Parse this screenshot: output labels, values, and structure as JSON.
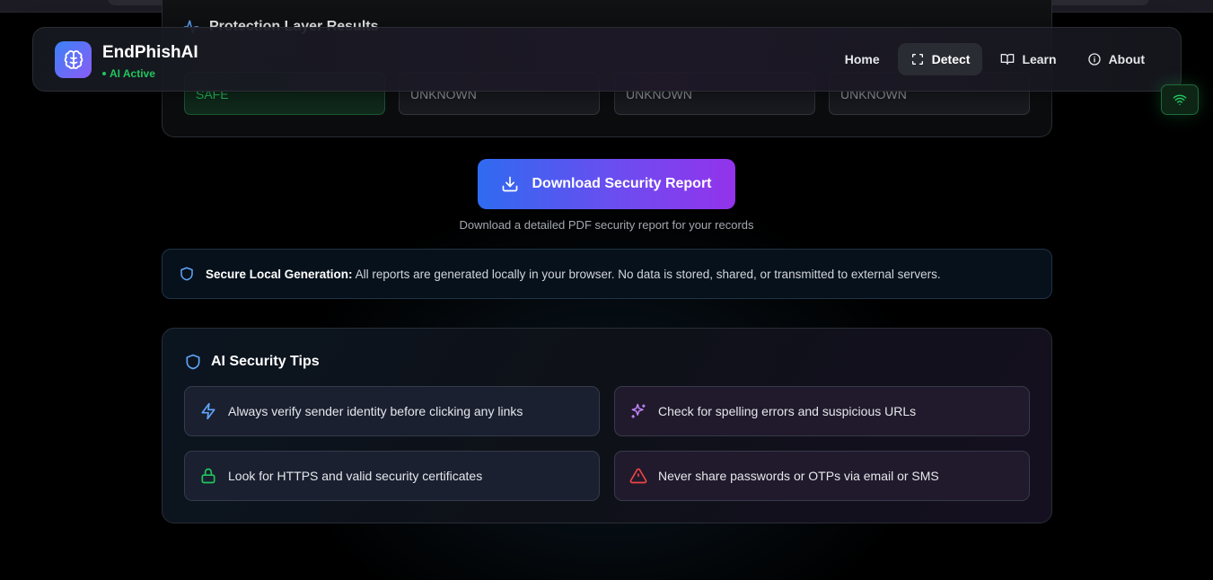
{
  "results": {
    "title": "Protection Layer Results",
    "layers": [
      "SAFE",
      "UNKNOWN",
      "UNKNOWN",
      "UNKNOWN"
    ]
  },
  "nav": {
    "brand": "EndPhishAI",
    "status": "AI Active",
    "links": [
      {
        "label": "Home",
        "icon": "home"
      },
      {
        "label": "Detect",
        "icon": "scan-icon",
        "active": true
      },
      {
        "label": "Learn",
        "icon": "book-icon"
      },
      {
        "label": "About",
        "icon": "info-icon"
      }
    ]
  },
  "download": {
    "label": "Download Security Report",
    "hint": "Download a detailed PDF security report for your records"
  },
  "secure_note": {
    "title": "Secure Local Generation:",
    "text": "All reports are generated locally in your browser. No data is stored, shared, or transmitted to external servers."
  },
  "tips": {
    "title": "AI Security Tips",
    "items": [
      {
        "text": "Always verify sender identity before clicking any links",
        "icon": "lightning-icon"
      },
      {
        "text": "Check for spelling errors and suspicious URLs",
        "icon": "sparkles-icon"
      },
      {
        "text": "Look for HTTPS and valid security certificates",
        "icon": "lock-icon"
      },
      {
        "text": "Never share passwords or OTPs via email or SMS",
        "icon": "warning-icon"
      }
    ]
  },
  "colors": {
    "accent_green": "#22c55e",
    "gradient_start": "#3b82f6",
    "gradient_end": "#9333ea"
  }
}
